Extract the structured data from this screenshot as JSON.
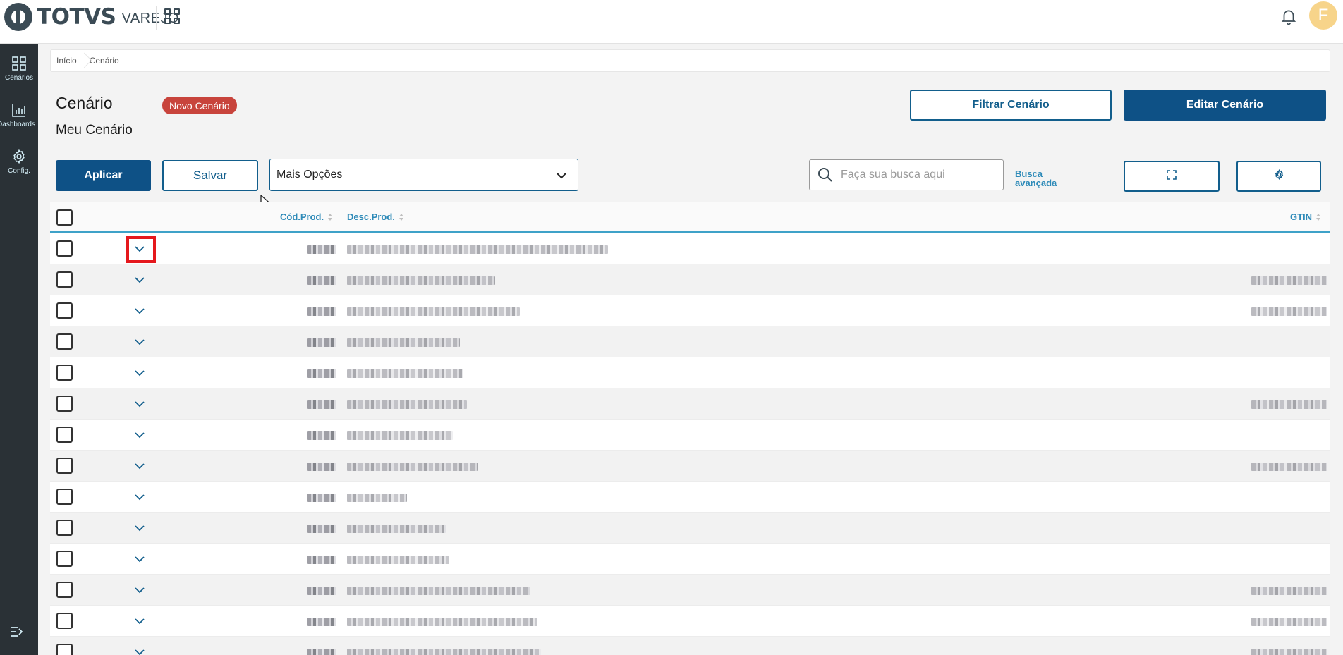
{
  "app": {
    "logo_text": "TOTVS",
    "logo_sub": "VAREJO",
    "avatar_initial": "F"
  },
  "sidebar": {
    "items": [
      {
        "label": "Cenários",
        "icon": "grid-icon"
      },
      {
        "label": "Dashboards",
        "icon": "bar-chart-icon"
      },
      {
        "label": "Config.",
        "icon": "gear-icon"
      }
    ],
    "bottom_icon": "collapse-menu-icon"
  },
  "breadcrumb": [
    "Início",
    "Cenário"
  ],
  "header": {
    "title": "Cenário",
    "subtitle": "Meu Cenário",
    "badge": "Novo Cenário",
    "filter_button": "Filtrar Cenário",
    "edit_button": "Editar Cenário"
  },
  "toolbar": {
    "apply_button": "Aplicar",
    "save_button": "Salvar",
    "options_select": "Mais Opções",
    "search_placeholder": "Faça sua busca aqui",
    "advanced_search_line1": "Busca",
    "advanced_search_line2": "avançada",
    "fullscreen_icon": "fullscreen-icon",
    "settings_icon": "gear-icon"
  },
  "table": {
    "columns": [
      "Cód.Prod.",
      "Desc.Prod.",
      "GTIN"
    ],
    "row_count_visible": 14
  },
  "colors": {
    "primary": "#0e5186",
    "link": "#2d8ab8",
    "badge": "#c8443c",
    "sidebar": "#2a3136",
    "highlight": "#e5181d"
  }
}
